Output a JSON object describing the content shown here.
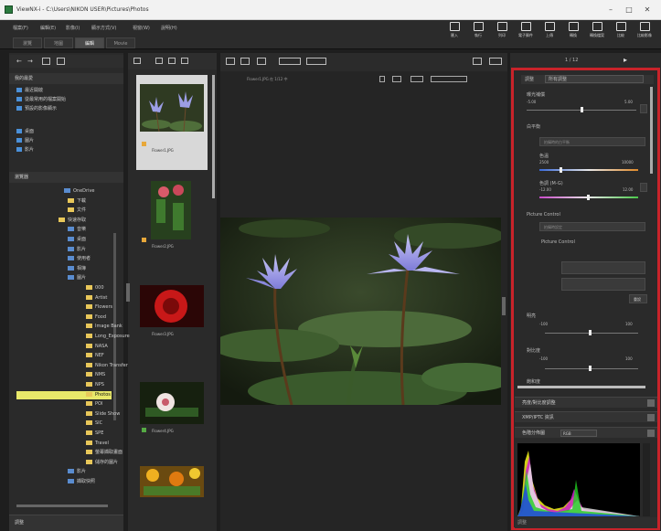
{
  "window": {
    "title": "ViewNX-i - C:\\Users\\NIKON USER\\Pictures\\Photos",
    "minimize": "–",
    "maximize": "□",
    "close": "✕"
  },
  "menu": [
    "檔案(F)",
    "編輯(E)",
    "影像(I)",
    "顯示方式(V)",
    "視窗(W)",
    "說明(H)"
  ],
  "tabs": [
    "瀏覽",
    "地圖",
    "編輯",
    "Movie"
  ],
  "toolbar": [
    {
      "label": "匯入",
      "icon": "import-icon"
    },
    {
      "label": "執行",
      "icon": "run-icon"
    },
    {
      "label": "列印",
      "icon": "print-icon"
    },
    {
      "label": "電子郵件",
      "icon": "mail-icon"
    },
    {
      "label": "上傳",
      "icon": "upload-icon"
    },
    {
      "label": "轉換",
      "icon": "convert-icon"
    },
    {
      "label": "轉換檔案",
      "icon": "file-convert-icon"
    },
    {
      "label": "比較",
      "icon": "compare-icon"
    },
    {
      "label": "比較影像",
      "icon": "compare-images-icon"
    }
  ],
  "left_panel": {
    "favorites_header": "我的最愛",
    "favorites": [
      "最近開啟",
      "從最常用的檔案開始",
      "預設的影像顯示"
    ],
    "places": [
      "桌面",
      "圖片",
      "影片"
    ],
    "browser_header": "瀏覽器",
    "tree": [
      {
        "label": "OneDrive",
        "indent": 60,
        "type": "drive"
      },
      {
        "label": "下載",
        "indent": 64,
        "type": "folder"
      },
      {
        "label": "文件",
        "indent": 64,
        "type": "folder"
      },
      {
        "label": "快速存取",
        "indent": 54,
        "type": "folder"
      },
      {
        "label": "音樂",
        "indent": 64,
        "type": "drive"
      },
      {
        "label": "桌面",
        "indent": 64,
        "type": "drive"
      },
      {
        "label": "影片",
        "indent": 64,
        "type": "drive"
      },
      {
        "label": "使用者",
        "indent": 64,
        "type": "drive"
      },
      {
        "label": "相簿",
        "indent": 64,
        "type": "drive"
      },
      {
        "label": "圖片",
        "indent": 64,
        "type": "drive"
      },
      {
        "label": "000",
        "indent": 84,
        "type": "folder"
      },
      {
        "label": "Artist",
        "indent": 84,
        "type": "folder"
      },
      {
        "label": "Flowers",
        "indent": 84,
        "type": "folder"
      },
      {
        "label": "Food",
        "indent": 84,
        "type": "folder"
      },
      {
        "label": "Image Bank",
        "indent": 84,
        "type": "folder"
      },
      {
        "label": "Long_Exposure",
        "indent": 84,
        "type": "folder"
      },
      {
        "label": "NASA",
        "indent": 84,
        "type": "folder"
      },
      {
        "label": "NEF",
        "indent": 84,
        "type": "folder"
      },
      {
        "label": "Nikon Transfer",
        "indent": 84,
        "type": "folder"
      },
      {
        "label": "NMS",
        "indent": 84,
        "type": "folder"
      },
      {
        "label": "NPS",
        "indent": 84,
        "type": "folder"
      },
      {
        "label": "Photos",
        "indent": 84,
        "type": "folder",
        "selected": true
      },
      {
        "label": "POI",
        "indent": 84,
        "type": "folder"
      },
      {
        "label": "Slide Show",
        "indent": 84,
        "type": "folder"
      },
      {
        "label": "SIC",
        "indent": 84,
        "type": "folder"
      },
      {
        "label": "SPE",
        "indent": 84,
        "type": "folder"
      },
      {
        "label": "Travel",
        "indent": 84,
        "type": "folder"
      },
      {
        "label": "螢幕擷取畫面",
        "indent": 84,
        "type": "folder"
      },
      {
        "label": "儲存的圖片",
        "indent": 84,
        "type": "folder"
      },
      {
        "label": "影片",
        "indent": 64,
        "type": "drive"
      },
      {
        "label": "擷取快照",
        "indent": 64,
        "type": "drive"
      }
    ],
    "bottom_label": "調整"
  },
  "thumbnails": [
    {
      "name": "Flower1.JPG",
      "flag": "#e8a83a"
    },
    {
      "name": "Flower2.JPG",
      "flag": "#e8a83a"
    },
    {
      "name": "Flower3.JPG",
      "flag": ""
    },
    {
      "name": "Flower4.JPG",
      "flag": "#55aa44"
    },
    {
      "name": "Flower5.JPG",
      "flag": ""
    }
  ],
  "viewer": {
    "info": "Flower1.JPG 在 1/12 中",
    "counter": "1 / 12"
  },
  "right_panel": {
    "panel_label": "調整",
    "preset_value": "所有調整",
    "exposure_label": "曝光補償",
    "exposure_min": "-5.00",
    "exposure_max": "5.00",
    "wb_label": "白平衡",
    "wb_value": "拍攝時的白平衡",
    "temp_label": "色溫",
    "temp_min": "2500",
    "temp_max": "10000",
    "tint_label": "色調 (M-G)",
    "tint_min": "-12.00",
    "tint_max": "12.00",
    "picture_control_label": "Picture Control",
    "pc_value": "拍攝時設定",
    "pc_sub_label": "Picture Control",
    "reset_label": "重設",
    "brightness_label": "明亮",
    "brightness_min": "-100",
    "brightness_max": "100",
    "contrast_label": "對比度",
    "contrast_min": "-100",
    "contrast_max": "100",
    "saturation_label": "飽和度",
    "sections": [
      "亮度/對比度調整",
      "XMP/IPTC 資訊",
      "色階分佈圖"
    ],
    "histogram_channel": "RGB",
    "bottom_status": "調整"
  }
}
